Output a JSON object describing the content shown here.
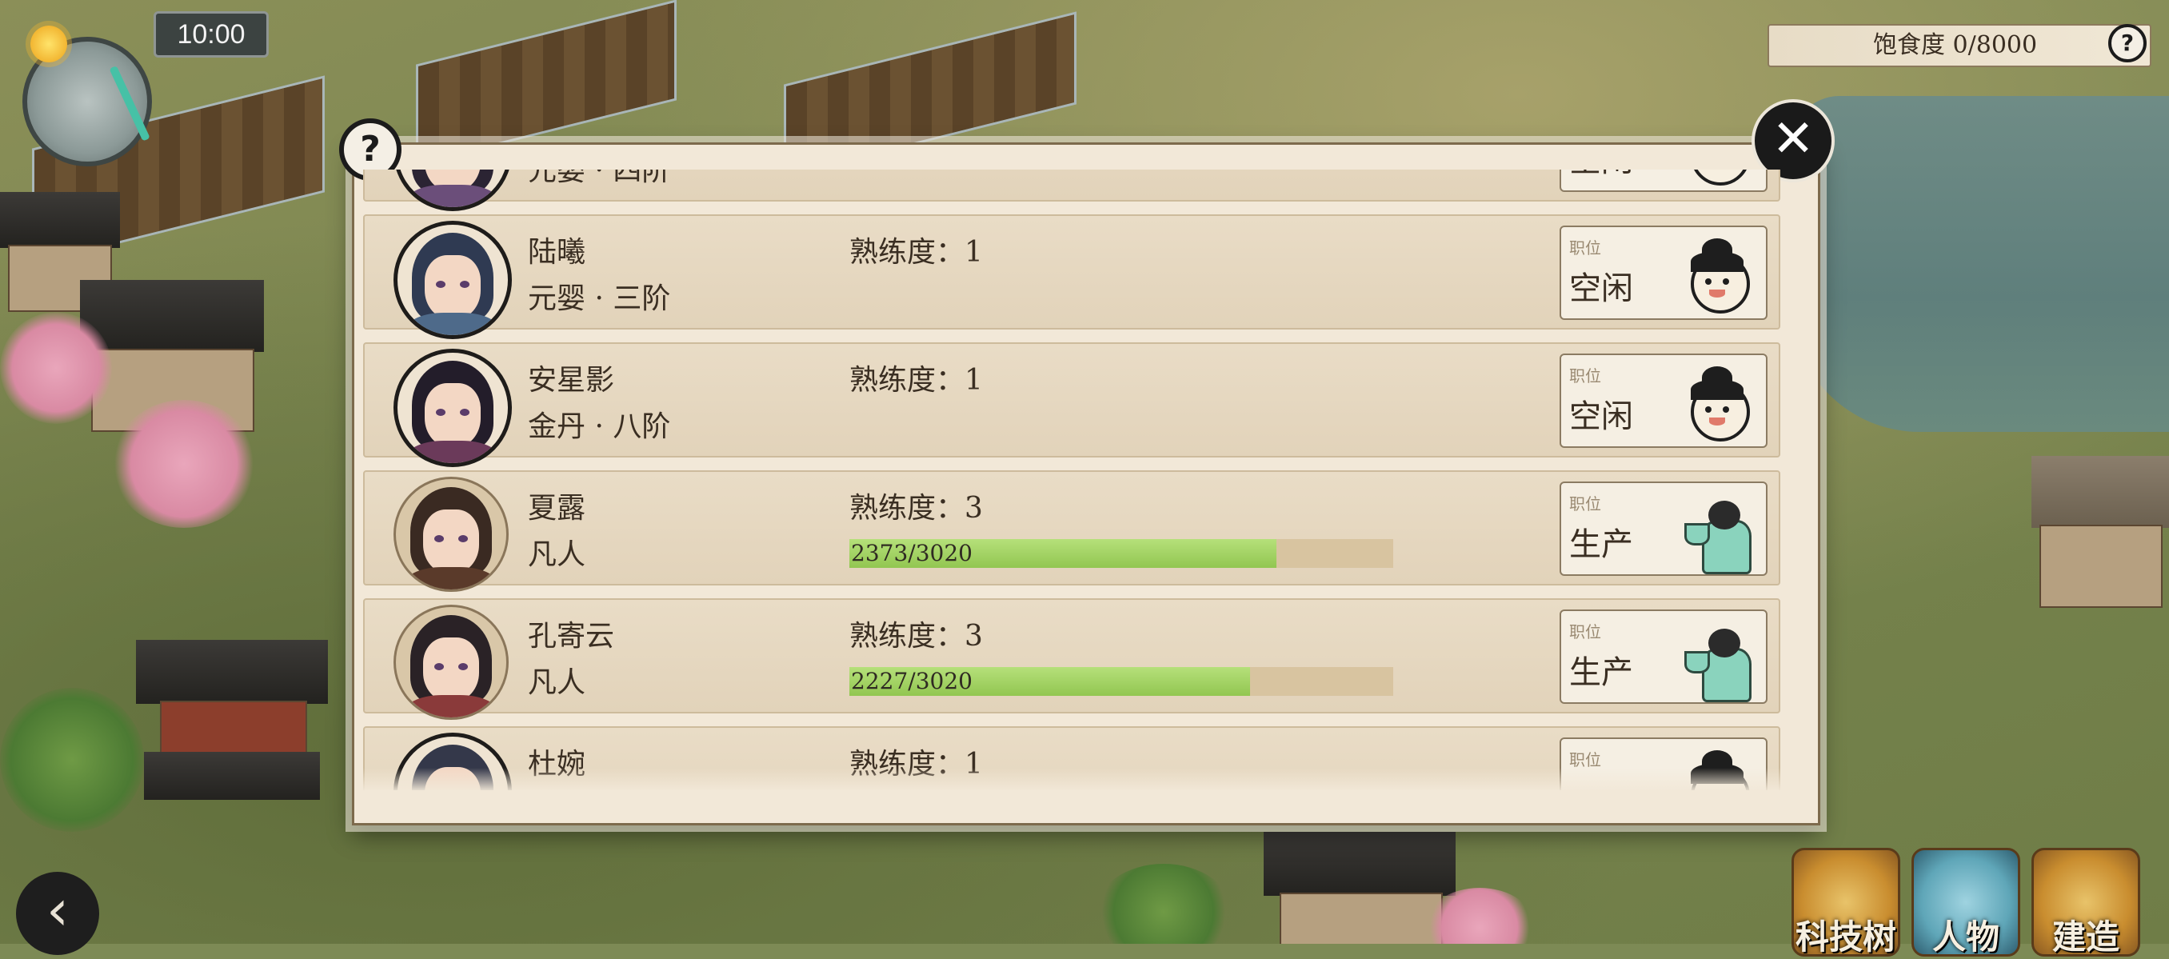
{
  "hud": {
    "time": "10:00",
    "satiety_label": "饱食度 0/8000",
    "help_glyph": "?"
  },
  "dialog": {
    "help_glyph": "?",
    "close_glyph": "✕",
    "job_caption": "职位",
    "proficiency_label": "熟练度："
  },
  "disciples": [
    {
      "name": "",
      "rank": "元婴 · 四阶",
      "proficiency": "",
      "job": "空闲",
      "job_icon": "idle-face-icon",
      "partial": "top"
    },
    {
      "name": "陆曦",
      "rank": "元婴 · 三阶",
      "proficiency": "1",
      "job": "空闲",
      "job_icon": "idle-face-icon"
    },
    {
      "name": "安星影",
      "rank": "金丹 · 八阶",
      "proficiency": "1",
      "job": "空闲",
      "job_icon": "idle-face-icon"
    },
    {
      "name": "夏露",
      "rank": "凡人",
      "proficiency": "3",
      "job": "生产",
      "job_icon": "production-worker-icon",
      "progress_text": "2373/3020",
      "progress_current": 2373,
      "progress_max": 3020
    },
    {
      "name": "孔寄云",
      "rank": "凡人",
      "proficiency": "3",
      "job": "生产",
      "job_icon": "production-worker-icon",
      "progress_text": "2227/3020",
      "progress_current": 2227,
      "progress_max": 3020
    },
    {
      "name": "杜婉",
      "rank": "",
      "proficiency": "1",
      "job": "",
      "job_icon": "idle-face-icon",
      "partial": "bottom"
    }
  ],
  "bottom_bar": {
    "back_glyph": "‹",
    "buttons": [
      {
        "label": "科技树",
        "icon": "tech-tree-icon"
      },
      {
        "label": "人物",
        "icon": "characters-icon"
      },
      {
        "label": "建造",
        "icon": "build-icon"
      }
    ]
  },
  "colors": {
    "progress_fill": "#9fd15e",
    "progress_track": "#d8c4a0",
    "panel_bg": "#f2e8d8"
  }
}
